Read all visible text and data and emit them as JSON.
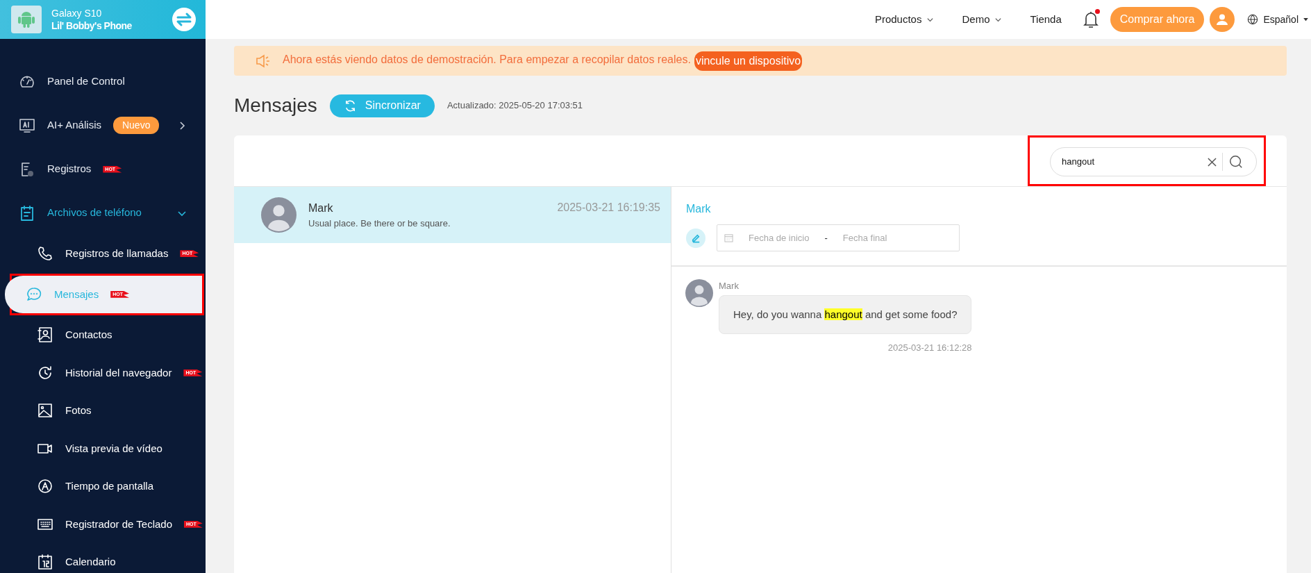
{
  "device": {
    "model": "Galaxy S10",
    "name": "Lil' Bobby's Phone"
  },
  "sidebar": {
    "items": [
      {
        "label": "Panel de Control",
        "selected": false
      },
      {
        "label": "AI+ Análisis",
        "badge": "Nuevo",
        "expanded": false,
        "selected": false
      },
      {
        "label": "Registros",
        "tag": "HOT",
        "selected": false
      },
      {
        "label": "Archivos de teléfono",
        "expanded": true,
        "children": [
          {
            "label": "Registros de llamadas",
            "tag": "HOT",
            "selected": false
          },
          {
            "label": "Mensajes",
            "tag": "HOT",
            "selected": true,
            "annotated": true
          },
          {
            "label": "Contactos",
            "selected": false
          },
          {
            "label": "Historial del navegador",
            "tag": "HOT",
            "selected": false
          },
          {
            "label": "Fotos",
            "selected": false
          },
          {
            "label": "Vista previa de vídeo",
            "selected": false
          },
          {
            "label": "Tiempo de pantalla",
            "selected": false
          },
          {
            "label": "Registrador de Teclado",
            "tag": "HOT",
            "selected": false
          },
          {
            "label": "Calendario",
            "selected": false
          }
        ]
      }
    ]
  },
  "topbar": {
    "menus": [
      {
        "label": "Productos",
        "dropdown": true
      },
      {
        "label": "Demo",
        "dropdown": true
      },
      {
        "label": "Tienda",
        "dropdown": false
      }
    ],
    "notifications": {
      "unread": true
    },
    "buy_button": "Comprar ahora",
    "language": "Español"
  },
  "banner": {
    "text": "Ahora estás viendo datos de demostración. Para empezar a recopilar datos reales.",
    "link": "vincule un dispositivo"
  },
  "page": {
    "title": "Mensajes",
    "sync_button": "Sincronizar",
    "updated": "Actualizado: 2025-05-20 17:03:51"
  },
  "search": {
    "value": "hangout",
    "annotated": true
  },
  "conversations": [
    {
      "name": "Mark",
      "preview": "Usual place. Be there or be square.",
      "time": "2025-03-21 16:19:35",
      "selected": true
    }
  ],
  "chat": {
    "contact": "Mark",
    "date_range": {
      "start_placeholder": "Fecha de inicio",
      "separator": "-",
      "end_placeholder": "Fecha final"
    },
    "messages": [
      {
        "sender": "Mark",
        "time": "2025-03-21 16:12:28",
        "segments": [
          {
            "text": "Hey, do you wanna ",
            "highlighted": false
          },
          {
            "text": "hangout",
            "highlighted": true
          },
          {
            "text": " and get some food?",
            "highlighted": false
          }
        ]
      }
    ]
  }
}
